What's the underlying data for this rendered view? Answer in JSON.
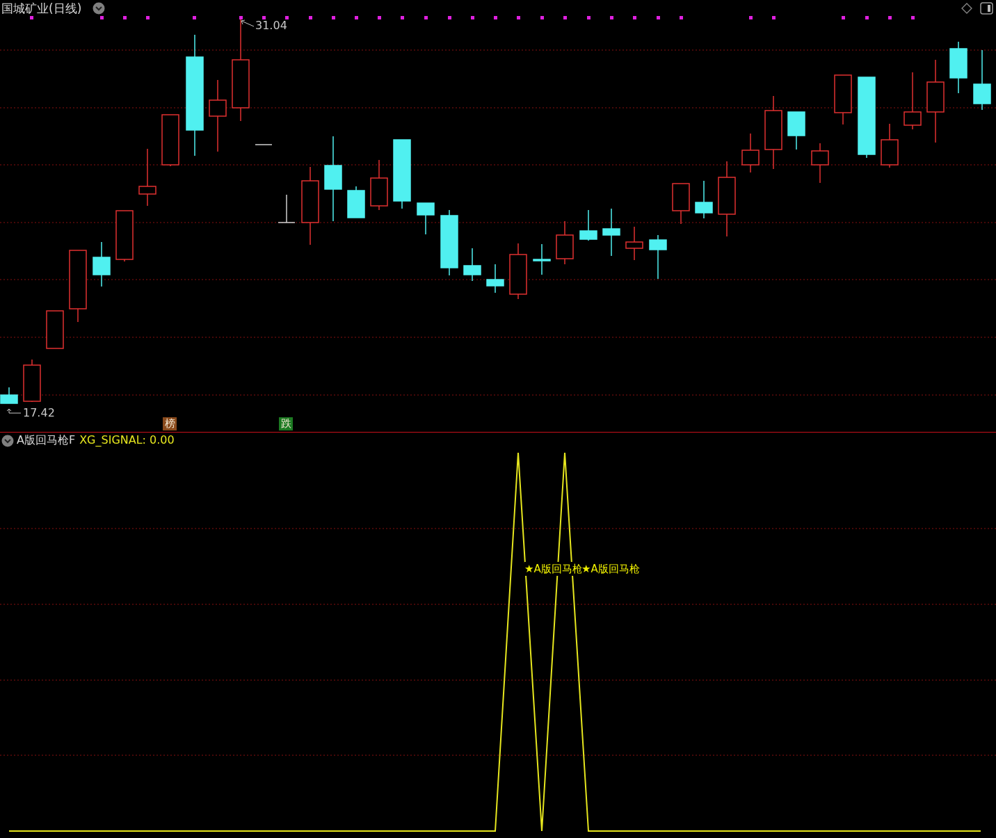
{
  "header": {
    "title": "国城矿业(日线)"
  },
  "price_chart": {
    "high_label": "31.04",
    "low_label": "17.42",
    "markers": [
      {
        "text": "榜",
        "color": "#8a4a1c"
      },
      {
        "text": "跌",
        "color": "#1c7a22"
      }
    ]
  },
  "indicator": {
    "name": "A版回马枪F",
    "reading": "XG_SIGNAL: 0.00",
    "signal_labels": [
      "★A版回马枪",
      "★A版回马枪"
    ]
  }
}
